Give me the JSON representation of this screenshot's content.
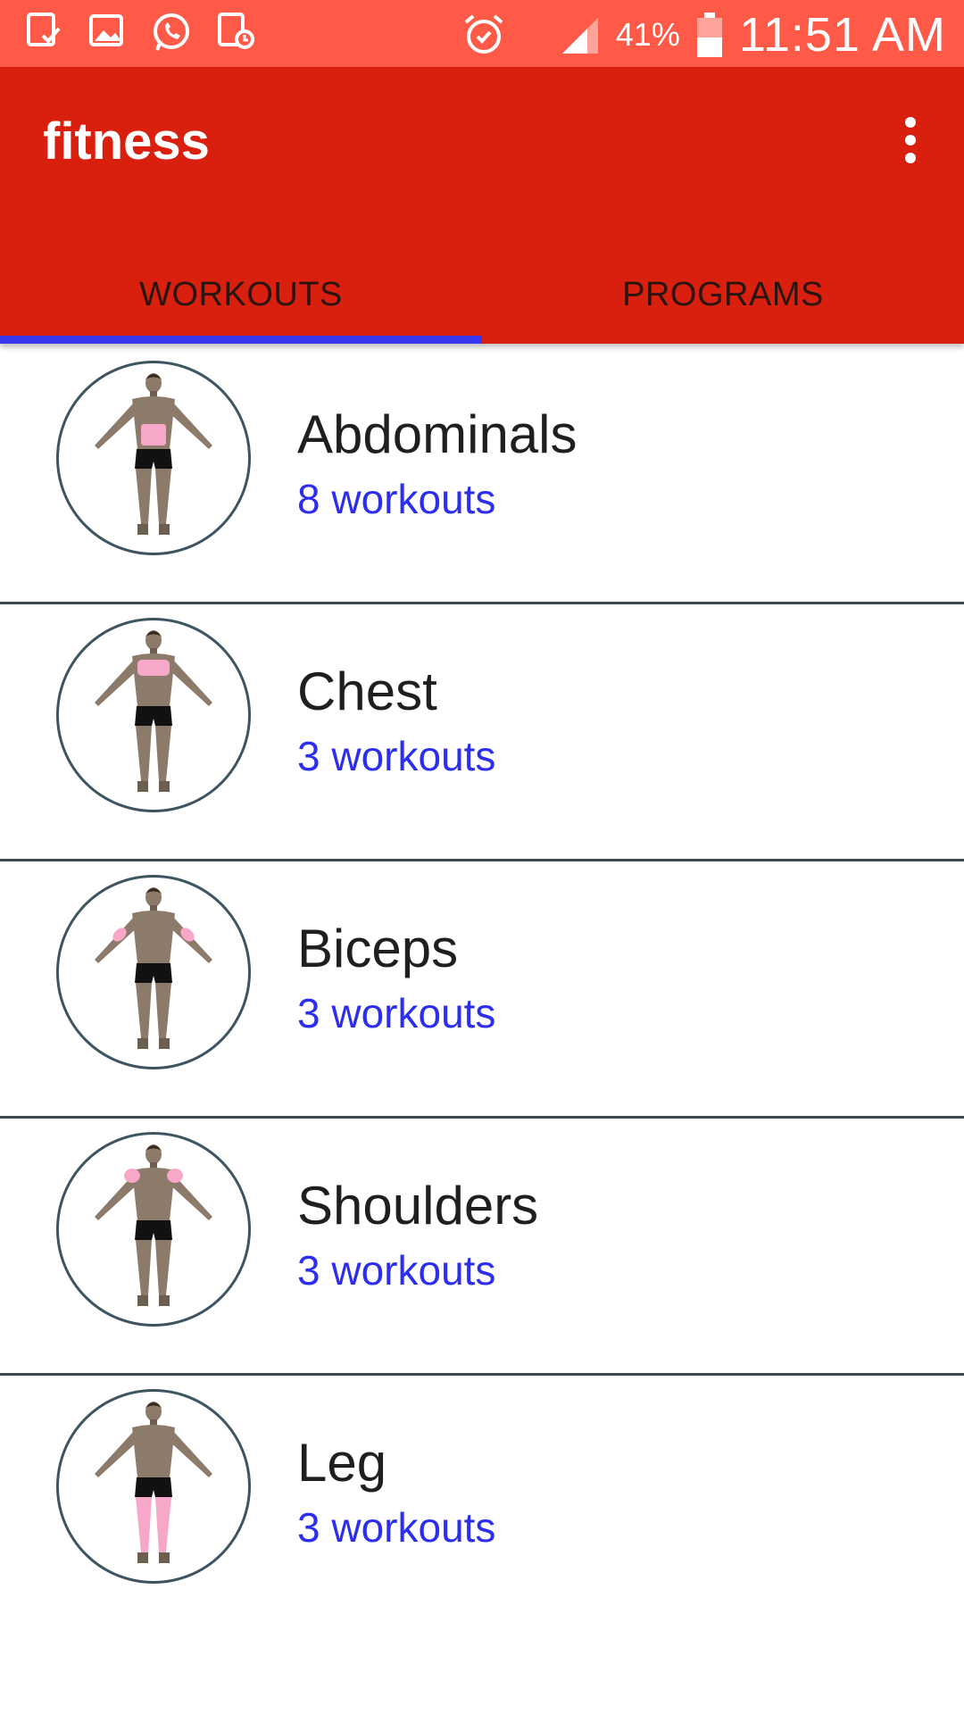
{
  "status_bar": {
    "battery_percent": "41%",
    "time": "11:51 AM",
    "icons": [
      "clipboard-check-icon",
      "image-icon",
      "whatsapp-icon",
      "schedule-icon",
      "alarm-icon",
      "signal-icon",
      "battery-icon"
    ]
  },
  "app_bar": {
    "title": "fitness",
    "menu_icon": "overflow-menu-icon"
  },
  "tabs": [
    {
      "label": "WORKOUTS",
      "selected": true
    },
    {
      "label": "PROGRAMS",
      "selected": false
    }
  ],
  "colors": {
    "status_bar": "#ff5a48",
    "app_bar": "#d9200e",
    "tab_indicator": "#3838f0",
    "subtitle": "#2d2df0",
    "highlight": "#f7a8c8"
  },
  "workouts": [
    {
      "title": "Abdominals",
      "subtitle": "8 workouts",
      "highlight_region": "abdominals"
    },
    {
      "title": "Chest",
      "subtitle": "3 workouts",
      "highlight_region": "chest"
    },
    {
      "title": "Biceps",
      "subtitle": "3 workouts",
      "highlight_region": "biceps"
    },
    {
      "title": "Shoulders",
      "subtitle": "3 workouts",
      "highlight_region": "shoulders"
    },
    {
      "title": "Leg",
      "subtitle": "3 workouts",
      "highlight_region": "legs"
    }
  ]
}
